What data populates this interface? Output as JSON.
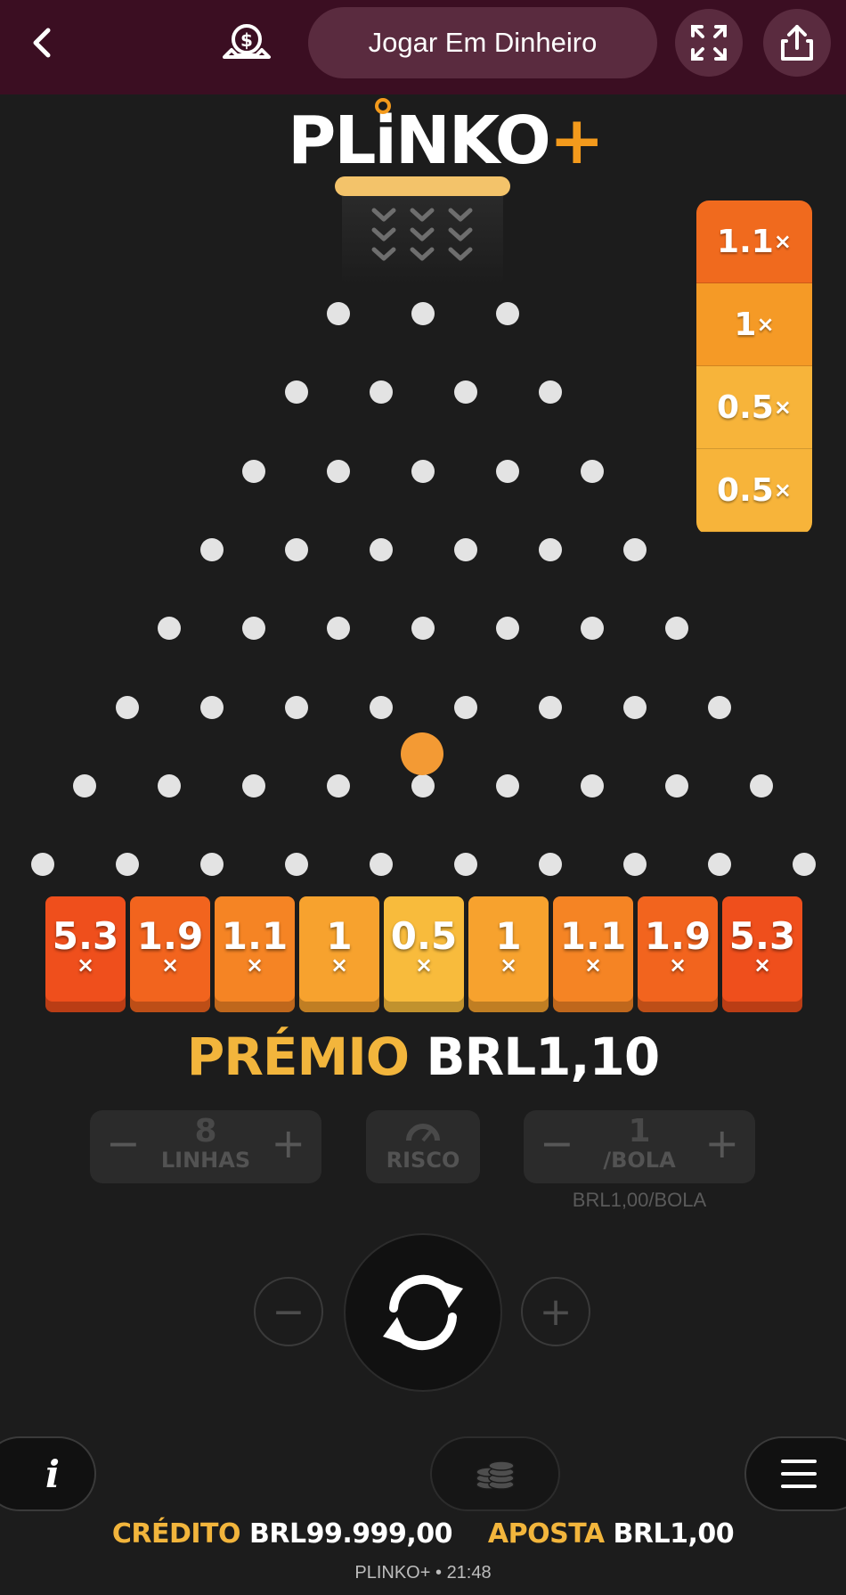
{
  "topbar": {
    "real_money_label": "Jogar Em Dinheiro",
    "icons": [
      "back-arrow-icon",
      "money-icon",
      "fullscreen-icon",
      "share-icon"
    ]
  },
  "game": {
    "logo_text": "PLiNKO",
    "logo_plus": "+",
    "history": [
      {
        "value": "1.1",
        "x": "×",
        "color": "#f06a1e"
      },
      {
        "value": "1",
        "x": "×",
        "color": "#f59a26"
      },
      {
        "value": "0.5",
        "x": "×",
        "color": "#f7b43a"
      },
      {
        "value": "0.5",
        "x": "×",
        "color": "#f7b43a"
      }
    ],
    "slots": [
      {
        "value": "5.3",
        "x": "×",
        "color": "#ef4f1c"
      },
      {
        "value": "1.9",
        "x": "×",
        "color": "#f2641e"
      },
      {
        "value": "1.1",
        "x": "×",
        "color": "#f58424"
      },
      {
        "value": "1",
        "x": "×",
        "color": "#f7a22e"
      },
      {
        "value": "0.5",
        "x": "×",
        "color": "#f8bb3c"
      },
      {
        "value": "1",
        "x": "×",
        "color": "#f7a22e"
      },
      {
        "value": "1.1",
        "x": "×",
        "color": "#f58424"
      },
      {
        "value": "1.9",
        "x": "×",
        "color": "#f2641e"
      },
      {
        "value": "5.3",
        "x": "×",
        "color": "#ef4f1c"
      }
    ],
    "prize_label": "PRÉMIO",
    "prize_amount": "BRL1,10"
  },
  "controls": {
    "lines_value": "8",
    "lines_label": "LINHAS",
    "risk_label": "RISCO",
    "ball_value": "1",
    "ball_label": "/BOLA",
    "per_ball": "BRL1,00/BOLA",
    "minus": "−",
    "plus": "+"
  },
  "footer": {
    "credit_label": "CRÉDITO",
    "credit_value": "BRL99.999,00",
    "bet_label": "APOSTA",
    "bet_value": "BRL1,00",
    "game_name": "PLINKO+",
    "time": "21:48",
    "separator": "•"
  },
  "colors": {
    "topbar_bg": "#3b0e22",
    "accent_orange": "#f39a1c",
    "label_gold": "#f2b53c",
    "background": "#1c1c1c"
  }
}
